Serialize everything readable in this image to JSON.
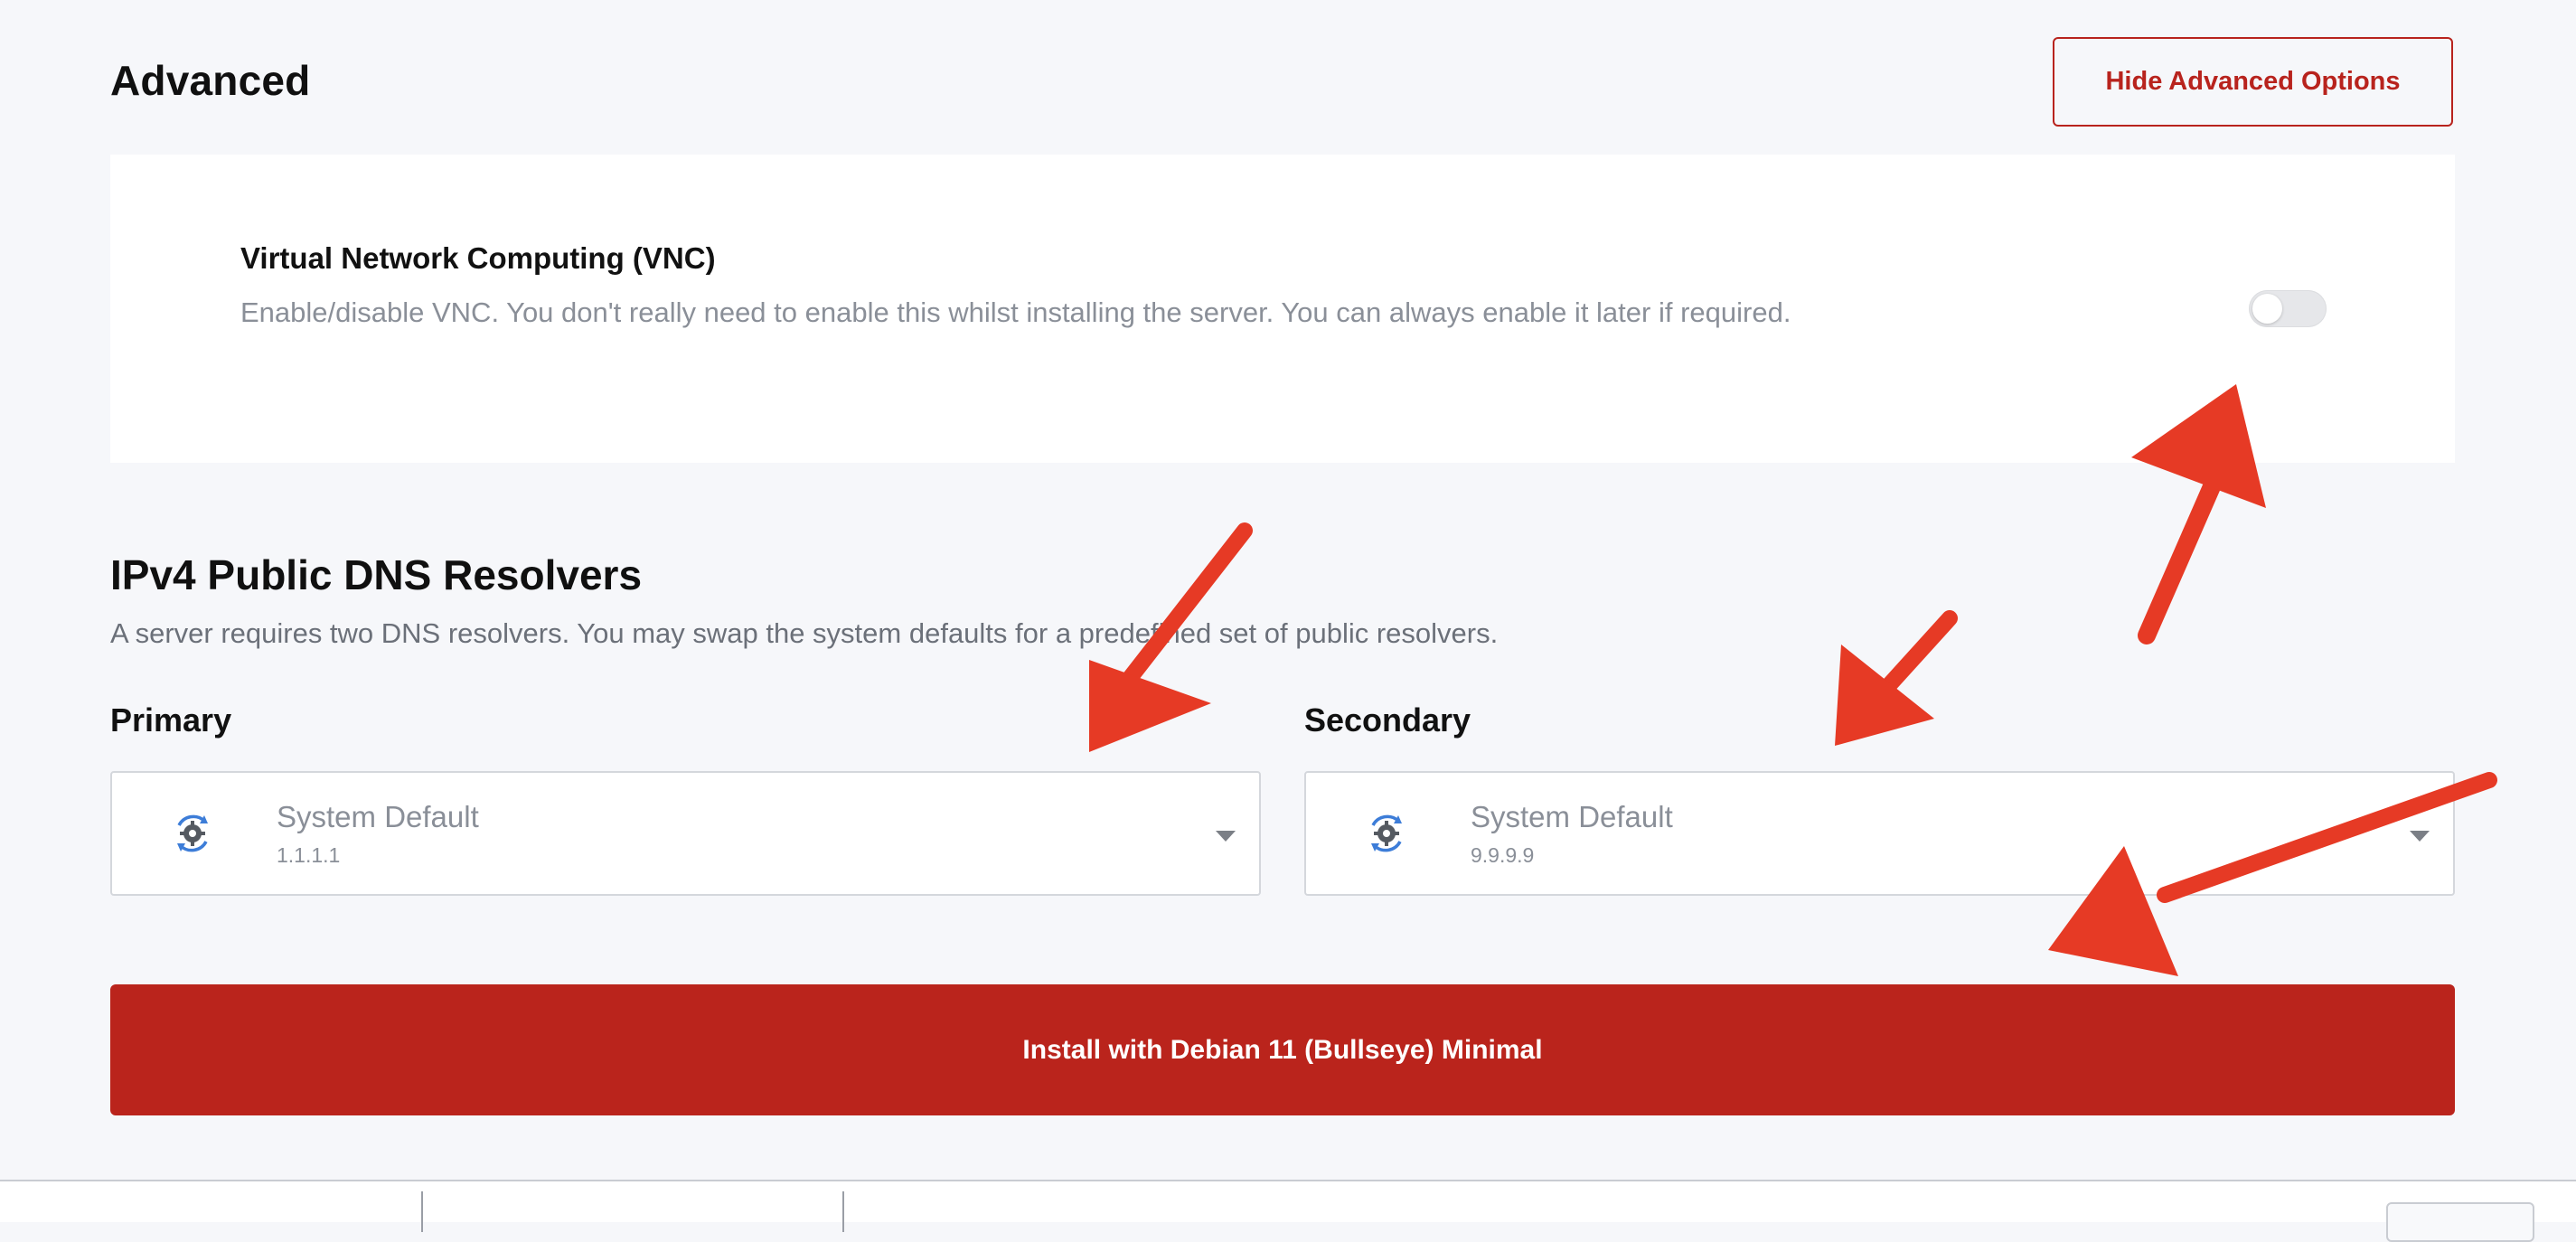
{
  "colors": {
    "accent": "#ba241c",
    "page_bg": "#f6f7fa",
    "card_bg": "#ffffff",
    "muted_text": "#8a8f98",
    "annotation_arrow": "#e63a25"
  },
  "advanced": {
    "title": "Advanced",
    "hide_button_label": "Hide Advanced Options"
  },
  "vnc": {
    "title": "Virtual Network Computing (VNC)",
    "description": "Enable/disable VNC. You don't really need to enable this whilst installing the server. You can always enable it later if required.",
    "enabled": false
  },
  "dns": {
    "title": "IPv4 Public DNS Resolvers",
    "description": "A server requires two DNS resolvers. You may swap the system defaults for a predefined set of public resolvers.",
    "primary": {
      "label": "Primary",
      "selected_name": "System Default",
      "selected_ip": "1.1.1.1",
      "icon": "system-settings-icon"
    },
    "secondary": {
      "label": "Secondary",
      "selected_name": "System Default",
      "selected_ip": "9.9.9.9",
      "icon": "system-settings-icon"
    }
  },
  "install_button_label": "Install with Debian 11 (Bullseye) Minimal"
}
